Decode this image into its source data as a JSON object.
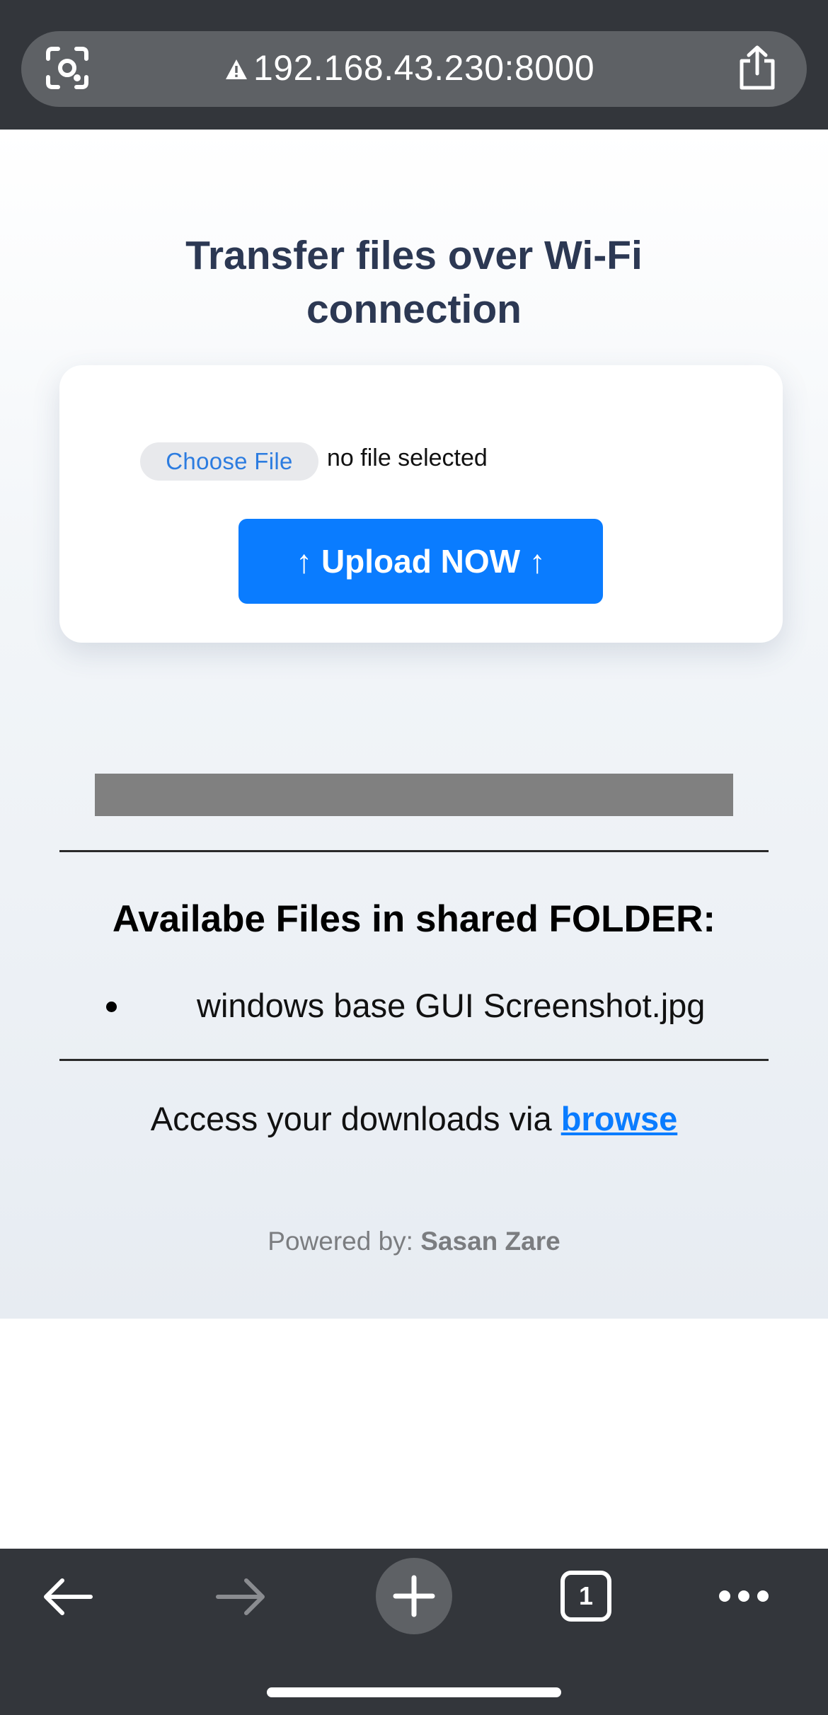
{
  "browser": {
    "url": "192.168.43.230:8000",
    "icons": {
      "lens": "lens-icon",
      "security": "warning-icon",
      "share": "share-icon"
    }
  },
  "page": {
    "heading": "Transfer files over Wi-Fi connection",
    "upload_form": {
      "choose_file_label": "Choose File",
      "file_status": "no file selected",
      "upload_button": "↑ Upload NOW ↑"
    },
    "progress": {
      "fraction": 1.0
    },
    "files_section": {
      "title": "Availabe Files in shared FOLDER:",
      "files": [
        "windows base GUI Screenshot.jpg"
      ]
    },
    "access": {
      "text": "Access your downloads via ",
      "link": "browse"
    },
    "footer": {
      "prefix": "Powered by: ",
      "author": "Sasan Zare"
    }
  },
  "toolbar": {
    "tab_count": "1",
    "icons": [
      "back-icon",
      "forward-icon",
      "new-tab-icon",
      "tabs-icon",
      "more-icon"
    ]
  },
  "colors": {
    "accent": "#0a7cff",
    "heading": "#2c3853",
    "browser_chrome": "#33363b"
  }
}
